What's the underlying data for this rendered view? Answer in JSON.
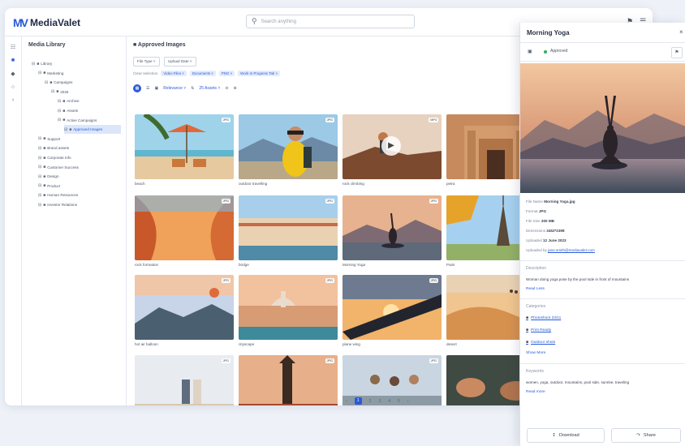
{
  "app": {
    "logo_mark": "MV",
    "logo_text": "MediaValet",
    "search_placeholder": "Search anything",
    "top_icons": [
      "bell-icon",
      "menu-icon"
    ]
  },
  "rail": {
    "icons": [
      "filter-icon",
      "folder-icon",
      "tag-icon",
      "share-icon",
      "collapse-icon"
    ],
    "active_index": 1
  },
  "tree": {
    "title": "Media Library",
    "items": [
      {
        "label": "Library",
        "level": 0
      },
      {
        "label": "Marketing",
        "level": 1
      },
      {
        "label": "Campaigns",
        "level": 2
      },
      {
        "label": "2025",
        "level": 3
      },
      {
        "label": "Archive",
        "level": 4
      },
      {
        "label": "Assets",
        "level": 4
      },
      {
        "label": "Active Campaigns",
        "level": 4
      },
      {
        "label": "Approved Images",
        "level": 5,
        "selected": true
      },
      {
        "label": "Support",
        "level": 1
      },
      {
        "label": "Brand assets",
        "level": 1
      },
      {
        "label": "Corporate Info",
        "level": 1
      },
      {
        "label": "Customer Success",
        "level": 1
      },
      {
        "label": "Design",
        "level": 1
      },
      {
        "label": "Product",
        "level": 1
      },
      {
        "label": "Human Resources",
        "level": 1
      },
      {
        "label": "Investor Relations",
        "level": 1
      }
    ]
  },
  "main": {
    "title": "Approved Images",
    "filters": [
      "File Type",
      "Upload Date"
    ],
    "chips_label": "Clear selection",
    "chips": [
      "Video Files",
      "Documents",
      "PNG",
      "Work In Progress Tab"
    ],
    "view": {
      "sort": "Relevance",
      "per_page": "25 Assets"
    },
    "cards": [
      {
        "caption": "beach",
        "badge": "JPG",
        "thumb": "beach"
      },
      {
        "caption": "outdoor travelling",
        "badge": "JPG",
        "thumb": "traveller"
      },
      {
        "caption": "rock climbing",
        "badge": "MP4",
        "thumb": "climb"
      },
      {
        "caption": "petra",
        "badge": "JPG",
        "thumb": "petra"
      },
      {
        "caption": "rock formation",
        "badge": "JPG",
        "thumb": "canyon"
      },
      {
        "caption": "bridge",
        "badge": "JPG",
        "thumb": "venice"
      },
      {
        "caption": "Morning Yoga",
        "badge": "JPG",
        "thumb": "yoga"
      },
      {
        "caption": "Paris",
        "badge": "JPG",
        "thumb": "paris"
      },
      {
        "caption": "hot air balloon",
        "badge": "JPG",
        "thumb": "balloon"
      },
      {
        "caption": "cityscape",
        "badge": "JPG",
        "thumb": "city"
      },
      {
        "caption": "plane wing",
        "badge": "JPG",
        "thumb": "plane"
      },
      {
        "caption": "desert",
        "badge": "JPG",
        "thumb": "desert"
      },
      {
        "caption": "",
        "badge": "JPG",
        "thumb": "couple"
      },
      {
        "caption": "",
        "badge": "JPG",
        "thumb": "pagoda"
      },
      {
        "caption": "",
        "badge": "JPG",
        "thumb": "friends"
      },
      {
        "caption": "",
        "badge": "JPG",
        "thumb": "hands"
      }
    ],
    "pagination": {
      "pages": [
        "1",
        "2",
        "3",
        "4",
        "5"
      ],
      "current": "1"
    }
  },
  "panel": {
    "title": "Morning Yoga",
    "status": "Approved",
    "meta": [
      {
        "label": "File Name",
        "value": "Morning Yoga.jpg"
      },
      {
        "label": "Format",
        "value": "JPG"
      },
      {
        "label": "File Size",
        "value": "300 MB"
      },
      {
        "label": "Dimensions",
        "value": "3452*2398"
      },
      {
        "label": "Uploaded",
        "value": "12 June 2023"
      },
      {
        "label": "Uploaded by",
        "value": "jane.smith@mediavalet.com"
      }
    ],
    "description_title": "Description",
    "description": "Woman doing yoga pose by the pool side in front of mountains",
    "read_less": "Read Less",
    "categories_title": "Categories",
    "categories": [
      "Photoshoot 23/11",
      "Print Ready",
      "Outdoor shots"
    ],
    "show_more": "Show More",
    "keywords_title": "Keywords",
    "keywords": "women, yoga, outdoor, mountains, pool side, sunrise, traveling",
    "read_more": "Read more",
    "download": "Download",
    "share": "Share"
  }
}
